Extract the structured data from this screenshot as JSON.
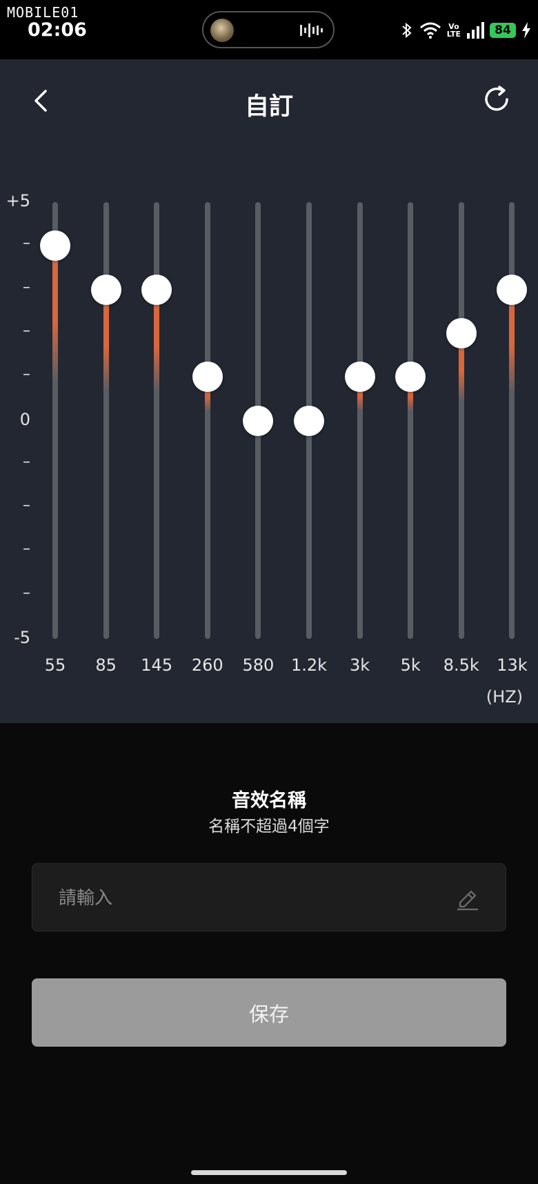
{
  "status_bar": {
    "logo": "MOBILE01",
    "time": "02:06",
    "battery": "84",
    "volte_top": "Vo",
    "volte_bottom": "LTE",
    "battery_color": "#34c759"
  },
  "header": {
    "title": "自訂",
    "back_icon": "chevron-left-icon",
    "reset_icon": "refresh-icon"
  },
  "equalizer": {
    "y_labels": [
      "+5",
      "–",
      "–",
      "–",
      "–",
      "0",
      "–",
      "–",
      "–",
      "–",
      "-5"
    ],
    "unit": "(HZ)",
    "fill_color": "#d9673c",
    "bands": [
      {
        "label": "55",
        "value": 4
      },
      {
        "label": "85",
        "value": 3
      },
      {
        "label": "145",
        "value": 3
      },
      {
        "label": "260",
        "value": 1
      },
      {
        "label": "580",
        "value": 0
      },
      {
        "label": "1.2k",
        "value": 0
      },
      {
        "label": "3k",
        "value": 1
      },
      {
        "label": "5k",
        "value": 1
      },
      {
        "label": "8.5k",
        "value": 2
      },
      {
        "label": "13k",
        "value": 3
      }
    ],
    "range": [
      -5,
      5
    ]
  },
  "name_section": {
    "title": "音效名稱",
    "hint": "名稱不超過4個字",
    "placeholder": "請輸入",
    "value": "",
    "edit_icon": "edit-icon"
  },
  "save_button": {
    "label": "保存"
  }
}
